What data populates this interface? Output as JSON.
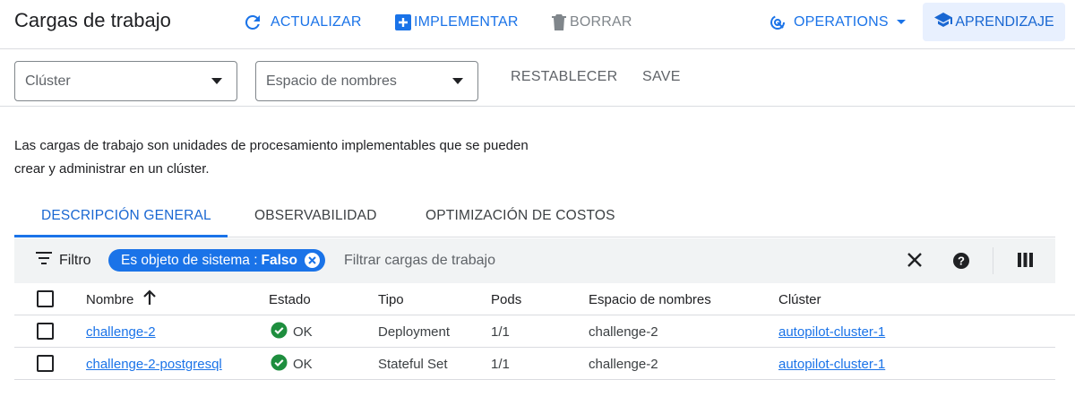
{
  "header": {
    "title": "Cargas de trabajo",
    "refresh_label": "ACTUALIZAR",
    "deploy_label": "IMPLEMENTAR",
    "delete_label": "BORRAR",
    "operations_label": "OPERATIONS",
    "learn_label": "APRENDIZAJE"
  },
  "filters": {
    "cluster_placeholder": "Clúster",
    "namespace_placeholder": "Espacio de nombres",
    "reset_label": "RESTABLECER",
    "save_label": "SAVE"
  },
  "description": {
    "line1": "Las cargas de trabajo son unidades de procesamiento implementables que se pueden",
    "line2": "crear y administrar en un clúster."
  },
  "tabs": [
    {
      "label": "DESCRIPCIÓN GENERAL",
      "active": true
    },
    {
      "label": "OBSERVABILIDAD",
      "active": false
    },
    {
      "label": "OPTIMIZACIÓN DE COSTOS",
      "active": false
    }
  ],
  "filter_bar": {
    "label": "Filtro",
    "chip_key": "Es objeto de sistema :",
    "chip_value": "Falso",
    "input_placeholder": "Filtrar cargas de trabajo"
  },
  "table": {
    "columns": {
      "name": "Nombre",
      "status": "Estado",
      "type": "Tipo",
      "pods": "Pods",
      "namespace": "Espacio de nombres",
      "cluster": "Clúster"
    },
    "rows": [
      {
        "name": "challenge-2",
        "status": "OK",
        "type": "Deployment",
        "pods": "1/1",
        "namespace": "challenge-2",
        "cluster": "autopilot-cluster-1"
      },
      {
        "name": "challenge-2-postgresql",
        "status": "OK",
        "type": "Stateful Set",
        "pods": "1/1",
        "namespace": "challenge-2",
        "cluster": "autopilot-cluster-1"
      }
    ]
  },
  "colors": {
    "accent": "#1a73e8",
    "status_ok": "#1e8e3e",
    "chip_bg": "#1a73e8",
    "learn_bg": "#e8f0fe"
  },
  "icons": {
    "refresh": "refresh-icon",
    "deploy": "add-box-icon",
    "delete": "trash-icon",
    "operations": "operations-icon",
    "learn": "school-icon",
    "filter": "filter-list-icon",
    "clear": "close-icon",
    "help": "help-icon",
    "columns": "column-view-icon",
    "sort": "arrow-up-icon",
    "ok": "check-circle-icon"
  }
}
